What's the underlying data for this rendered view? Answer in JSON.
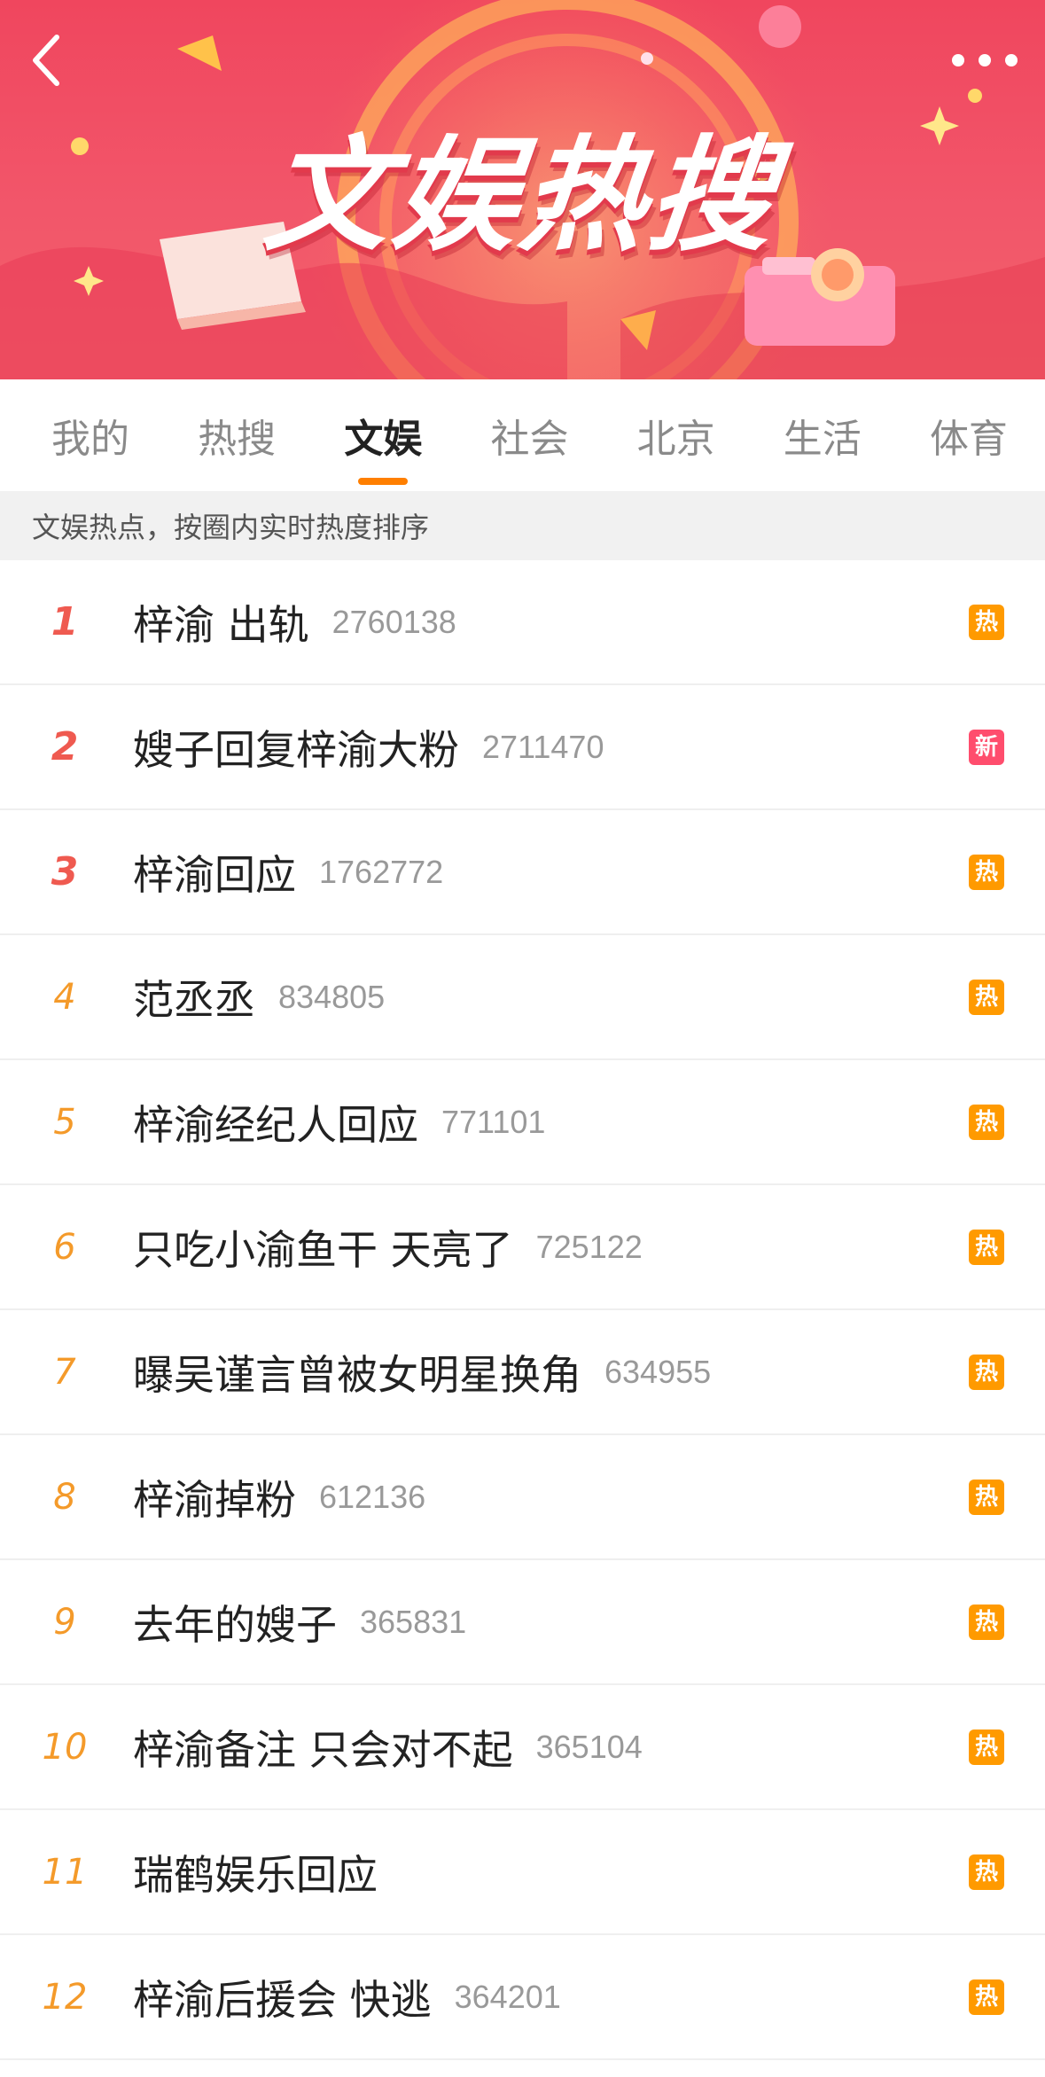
{
  "banner": {
    "title": "文娱热搜",
    "back_icon": "chevron-left-icon",
    "more_icon": "more-dots-icon"
  },
  "tabs": [
    {
      "label": "我的",
      "active": false
    },
    {
      "label": "热搜",
      "active": false
    },
    {
      "label": "文娱",
      "active": true
    },
    {
      "label": "社会",
      "active": false
    },
    {
      "label": "北京",
      "active": false
    },
    {
      "label": "生活",
      "active": false
    },
    {
      "label": "体育",
      "active": false
    }
  ],
  "subheader": "文娱热点，按圈内实时热度排序",
  "colors": {
    "accent": "#ff7f00",
    "rank_top": "#ef5a50",
    "rank_other": "#f49a2a",
    "badge_hot": "#ff9a00",
    "badge_new": "#ff4d6d"
  },
  "items": [
    {
      "rank": "1",
      "title": "梓渝 出轨",
      "count": "2760138",
      "badge": "热",
      "badge_type": "hot"
    },
    {
      "rank": "2",
      "title": "嫂子回复梓渝大粉",
      "count": "2711470",
      "badge": "新",
      "badge_type": "new"
    },
    {
      "rank": "3",
      "title": "梓渝回应",
      "count": "1762772",
      "badge": "热",
      "badge_type": "hot"
    },
    {
      "rank": "4",
      "title": "范丞丞",
      "count": "834805",
      "badge": "热",
      "badge_type": "hot"
    },
    {
      "rank": "5",
      "title": "梓渝经纪人回应",
      "count": "771101",
      "badge": "热",
      "badge_type": "hot"
    },
    {
      "rank": "6",
      "title": "只吃小渝鱼干 天亮了",
      "count": "725122",
      "badge": "热",
      "badge_type": "hot"
    },
    {
      "rank": "7",
      "title": "曝吴谨言曾被女明星换角",
      "count": "634955",
      "badge": "热",
      "badge_type": "hot"
    },
    {
      "rank": "8",
      "title": "梓渝掉粉",
      "count": "612136",
      "badge": "热",
      "badge_type": "hot"
    },
    {
      "rank": "9",
      "title": "去年的嫂子",
      "count": "365831",
      "badge": "热",
      "badge_type": "hot"
    },
    {
      "rank": "10",
      "title": "梓渝备注 只会对不起",
      "count": "365104",
      "badge": "热",
      "badge_type": "hot"
    },
    {
      "rank": "11",
      "title": "瑞鹤娱乐回应",
      "count": "",
      "badge": "热",
      "badge_type": "hot"
    },
    {
      "rank": "12",
      "title": "梓渝后援会 快逃",
      "count": "364201",
      "badge": "热",
      "badge_type": "hot"
    }
  ]
}
